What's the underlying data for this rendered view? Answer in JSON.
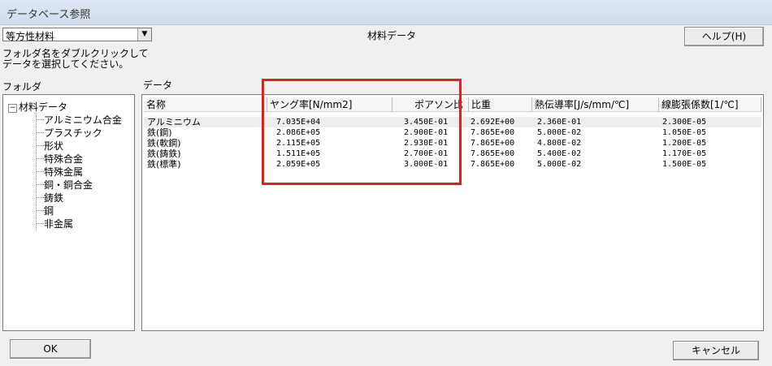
{
  "window": {
    "title": "データベース参照"
  },
  "material_type_select": {
    "value": "等方性材料"
  },
  "center_title": "材料データ",
  "help_button": "ヘルプ(H)",
  "instructions": [
    "フォルダ名をダブルクリックして",
    "データを選択してください。"
  ],
  "folder_label": "フォルダ",
  "data_label": "データ",
  "tree": {
    "root": "材料データ",
    "items": [
      "アルミニウム合金",
      "プラスチック",
      "形状",
      "特殊合金",
      "特殊金属",
      "銅・銅合金",
      "鋳鉄",
      "鋼",
      "非金属"
    ]
  },
  "table": {
    "columns": [
      "名称",
      "ヤング率[N/mm2]",
      "ポアソン比",
      "比重",
      "熱伝導率[J/s/mm/℃]",
      "線膨張係数[1/℃]"
    ],
    "rows": [
      [
        "アルミニウム",
        "7.035E+04",
        "3.450E-01",
        "2.692E+00",
        "2.360E-01",
        "2.300E-05"
      ],
      [
        "鉄(鋼)",
        "2.086E+05",
        "2.900E-01",
        "7.865E+00",
        "5.000E-02",
        "1.050E-05"
      ],
      [
        "鉄(軟鋼)",
        "2.115E+05",
        "2.930E-01",
        "7.865E+00",
        "4.800E-02",
        "1.200E-05"
      ],
      [
        "鉄(鋳鉄)",
        "1.511E+05",
        "2.700E-01",
        "7.865E+00",
        "5.400E-02",
        "1.170E-05"
      ],
      [
        "鉄(標準)",
        "2.059E+05",
        "3.000E-01",
        "7.865E+00",
        "5.000E-02",
        "1.500E-05"
      ]
    ]
  },
  "ok_button": "OK",
  "cancel_button": "キャンセル",
  "colors": {
    "highlight": "#e21e1e"
  }
}
